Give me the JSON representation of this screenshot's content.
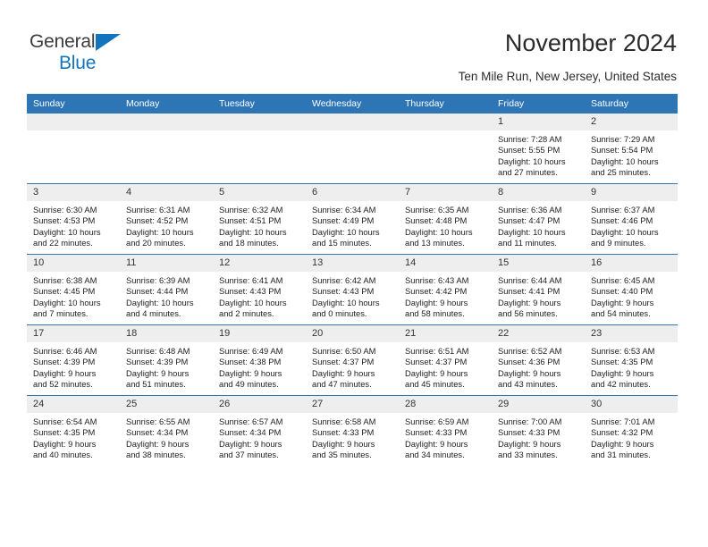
{
  "brand": {
    "line1": "General",
    "line2": "Blue",
    "triangle_icon": "brand-triangle-icon",
    "accent_color": "#1274bc"
  },
  "header": {
    "month_title": "November 2024",
    "location": "Ten Mile Run, New Jersey, United States"
  },
  "theme": {
    "header_blue": "#2e75b6",
    "daynum_band": "#eeeeee",
    "text": "#222222"
  },
  "weekday_headers": [
    "Sunday",
    "Monday",
    "Tuesday",
    "Wednesday",
    "Thursday",
    "Friday",
    "Saturday"
  ],
  "weeks": [
    [
      {
        "day": "",
        "sunrise": "",
        "sunset": "",
        "daylight_1": "",
        "daylight_2": ""
      },
      {
        "day": "",
        "sunrise": "",
        "sunset": "",
        "daylight_1": "",
        "daylight_2": ""
      },
      {
        "day": "",
        "sunrise": "",
        "sunset": "",
        "daylight_1": "",
        "daylight_2": ""
      },
      {
        "day": "",
        "sunrise": "",
        "sunset": "",
        "daylight_1": "",
        "daylight_2": ""
      },
      {
        "day": "",
        "sunrise": "",
        "sunset": "",
        "daylight_1": "",
        "daylight_2": ""
      },
      {
        "day": "1",
        "sunrise": "Sunrise: 7:28 AM",
        "sunset": "Sunset: 5:55 PM",
        "daylight_1": "Daylight: 10 hours",
        "daylight_2": "and 27 minutes."
      },
      {
        "day": "2",
        "sunrise": "Sunrise: 7:29 AM",
        "sunset": "Sunset: 5:54 PM",
        "daylight_1": "Daylight: 10 hours",
        "daylight_2": "and 25 minutes."
      }
    ],
    [
      {
        "day": "3",
        "sunrise": "Sunrise: 6:30 AM",
        "sunset": "Sunset: 4:53 PM",
        "daylight_1": "Daylight: 10 hours",
        "daylight_2": "and 22 minutes."
      },
      {
        "day": "4",
        "sunrise": "Sunrise: 6:31 AM",
        "sunset": "Sunset: 4:52 PM",
        "daylight_1": "Daylight: 10 hours",
        "daylight_2": "and 20 minutes."
      },
      {
        "day": "5",
        "sunrise": "Sunrise: 6:32 AM",
        "sunset": "Sunset: 4:51 PM",
        "daylight_1": "Daylight: 10 hours",
        "daylight_2": "and 18 minutes."
      },
      {
        "day": "6",
        "sunrise": "Sunrise: 6:34 AM",
        "sunset": "Sunset: 4:49 PM",
        "daylight_1": "Daylight: 10 hours",
        "daylight_2": "and 15 minutes."
      },
      {
        "day": "7",
        "sunrise": "Sunrise: 6:35 AM",
        "sunset": "Sunset: 4:48 PM",
        "daylight_1": "Daylight: 10 hours",
        "daylight_2": "and 13 minutes."
      },
      {
        "day": "8",
        "sunrise": "Sunrise: 6:36 AM",
        "sunset": "Sunset: 4:47 PM",
        "daylight_1": "Daylight: 10 hours",
        "daylight_2": "and 11 minutes."
      },
      {
        "day": "9",
        "sunrise": "Sunrise: 6:37 AM",
        "sunset": "Sunset: 4:46 PM",
        "daylight_1": "Daylight: 10 hours",
        "daylight_2": "and 9 minutes."
      }
    ],
    [
      {
        "day": "10",
        "sunrise": "Sunrise: 6:38 AM",
        "sunset": "Sunset: 4:45 PM",
        "daylight_1": "Daylight: 10 hours",
        "daylight_2": "and 7 minutes."
      },
      {
        "day": "11",
        "sunrise": "Sunrise: 6:39 AM",
        "sunset": "Sunset: 4:44 PM",
        "daylight_1": "Daylight: 10 hours",
        "daylight_2": "and 4 minutes."
      },
      {
        "day": "12",
        "sunrise": "Sunrise: 6:41 AM",
        "sunset": "Sunset: 4:43 PM",
        "daylight_1": "Daylight: 10 hours",
        "daylight_2": "and 2 minutes."
      },
      {
        "day": "13",
        "sunrise": "Sunrise: 6:42 AM",
        "sunset": "Sunset: 4:43 PM",
        "daylight_1": "Daylight: 10 hours",
        "daylight_2": "and 0 minutes."
      },
      {
        "day": "14",
        "sunrise": "Sunrise: 6:43 AM",
        "sunset": "Sunset: 4:42 PM",
        "daylight_1": "Daylight: 9 hours",
        "daylight_2": "and 58 minutes."
      },
      {
        "day": "15",
        "sunrise": "Sunrise: 6:44 AM",
        "sunset": "Sunset: 4:41 PM",
        "daylight_1": "Daylight: 9 hours",
        "daylight_2": "and 56 minutes."
      },
      {
        "day": "16",
        "sunrise": "Sunrise: 6:45 AM",
        "sunset": "Sunset: 4:40 PM",
        "daylight_1": "Daylight: 9 hours",
        "daylight_2": "and 54 minutes."
      }
    ],
    [
      {
        "day": "17",
        "sunrise": "Sunrise: 6:46 AM",
        "sunset": "Sunset: 4:39 PM",
        "daylight_1": "Daylight: 9 hours",
        "daylight_2": "and 52 minutes."
      },
      {
        "day": "18",
        "sunrise": "Sunrise: 6:48 AM",
        "sunset": "Sunset: 4:39 PM",
        "daylight_1": "Daylight: 9 hours",
        "daylight_2": "and 51 minutes."
      },
      {
        "day": "19",
        "sunrise": "Sunrise: 6:49 AM",
        "sunset": "Sunset: 4:38 PM",
        "daylight_1": "Daylight: 9 hours",
        "daylight_2": "and 49 minutes."
      },
      {
        "day": "20",
        "sunrise": "Sunrise: 6:50 AM",
        "sunset": "Sunset: 4:37 PM",
        "daylight_1": "Daylight: 9 hours",
        "daylight_2": "and 47 minutes."
      },
      {
        "day": "21",
        "sunrise": "Sunrise: 6:51 AM",
        "sunset": "Sunset: 4:37 PM",
        "daylight_1": "Daylight: 9 hours",
        "daylight_2": "and 45 minutes."
      },
      {
        "day": "22",
        "sunrise": "Sunrise: 6:52 AM",
        "sunset": "Sunset: 4:36 PM",
        "daylight_1": "Daylight: 9 hours",
        "daylight_2": "and 43 minutes."
      },
      {
        "day": "23",
        "sunrise": "Sunrise: 6:53 AM",
        "sunset": "Sunset: 4:35 PM",
        "daylight_1": "Daylight: 9 hours",
        "daylight_2": "and 42 minutes."
      }
    ],
    [
      {
        "day": "24",
        "sunrise": "Sunrise: 6:54 AM",
        "sunset": "Sunset: 4:35 PM",
        "daylight_1": "Daylight: 9 hours",
        "daylight_2": "and 40 minutes."
      },
      {
        "day": "25",
        "sunrise": "Sunrise: 6:55 AM",
        "sunset": "Sunset: 4:34 PM",
        "daylight_1": "Daylight: 9 hours",
        "daylight_2": "and 38 minutes."
      },
      {
        "day": "26",
        "sunrise": "Sunrise: 6:57 AM",
        "sunset": "Sunset: 4:34 PM",
        "daylight_1": "Daylight: 9 hours",
        "daylight_2": "and 37 minutes."
      },
      {
        "day": "27",
        "sunrise": "Sunrise: 6:58 AM",
        "sunset": "Sunset: 4:33 PM",
        "daylight_1": "Daylight: 9 hours",
        "daylight_2": "and 35 minutes."
      },
      {
        "day": "28",
        "sunrise": "Sunrise: 6:59 AM",
        "sunset": "Sunset: 4:33 PM",
        "daylight_1": "Daylight: 9 hours",
        "daylight_2": "and 34 minutes."
      },
      {
        "day": "29",
        "sunrise": "Sunrise: 7:00 AM",
        "sunset": "Sunset: 4:33 PM",
        "daylight_1": "Daylight: 9 hours",
        "daylight_2": "and 33 minutes."
      },
      {
        "day": "30",
        "sunrise": "Sunrise: 7:01 AM",
        "sunset": "Sunset: 4:32 PM",
        "daylight_1": "Daylight: 9 hours",
        "daylight_2": "and 31 minutes."
      }
    ]
  ]
}
